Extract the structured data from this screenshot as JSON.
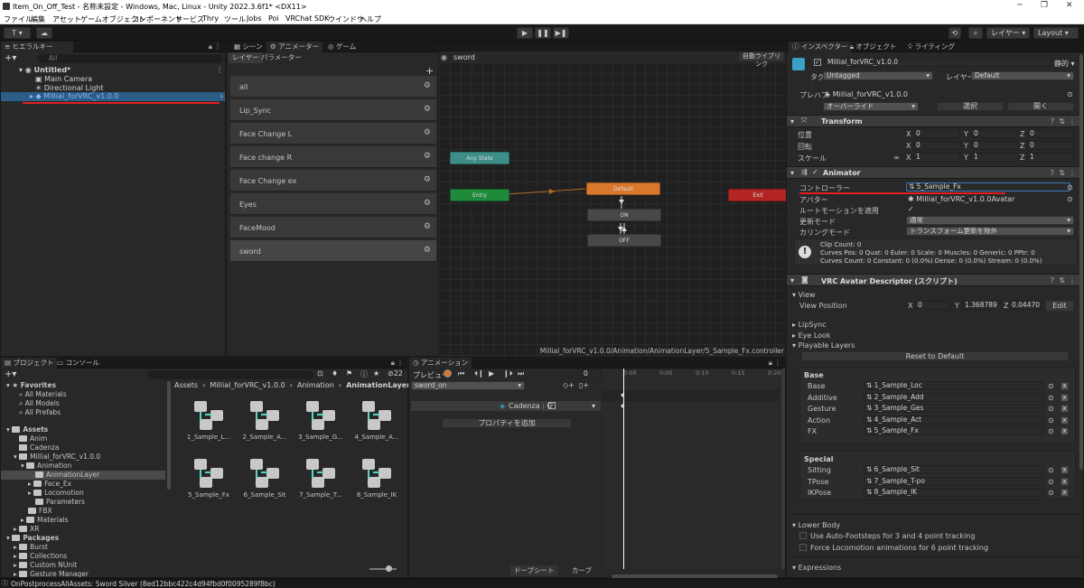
{
  "window": {
    "title": "Item_On_Off_Test - 名称未設定 - Windows, Mac, Linux - Unity 2022.3.6f1* <DX11>"
  },
  "menu": [
    "ファイル",
    "編集",
    "アセット",
    "ゲームオブジェクト",
    "コンポーネント",
    "サービス",
    "Thry",
    "ツール",
    "Jobs",
    "Poi",
    "VRChat SDK",
    "ウインドウ",
    "ヘルプ"
  ],
  "toolbar": {
    "account": "T",
    "layers": "レイヤー",
    "layout": "Layout"
  },
  "hierarchy": {
    "tab": "ヒエラルキー",
    "search_placeholder": "All",
    "scene": "Untitled*",
    "items": [
      "Main Camera",
      "Directional Light",
      "Millial_forVRC_v1.0.0"
    ]
  },
  "animator": {
    "tabs": [
      "シーン",
      "アニメーター",
      "ゲーム"
    ],
    "subtabs": [
      "レイヤー",
      "パラメーター"
    ],
    "breadcrumb": "sword",
    "auto_live_link": "自動ライブリンク",
    "layers": [
      "all",
      "Lip_Sync",
      "Face Change L",
      "Face change R",
      "Face Change ex",
      "Eyes",
      "FaceMood",
      "sword"
    ],
    "states": {
      "any": "Any State",
      "entry": "Entry",
      "default": "Default",
      "on": "ON",
      "off": "OFF",
      "exit": "Exit"
    },
    "path": "Millial_forVRC_v1.0.0/Animation/AnimationLayer/5_Sample_Fx.controller"
  },
  "inspector": {
    "tabs": [
      "インスペクター",
      "オブジェクト",
      "ライティング"
    ],
    "object_name": "Millial_forVRC_v1.0.0",
    "static": "静的",
    "tag_label": "タグ",
    "tag": "Untagged",
    "layer_label": "レイヤー",
    "layer": "Default",
    "prefab_label": "プレハブ",
    "prefab": "Millial_forVRC_v1.0.0",
    "overrides": "オーバーライド",
    "select": "選択",
    "open": "開く",
    "transform": {
      "title": "Transform",
      "position": "位置",
      "rotation": "回転",
      "scale": "スケール",
      "pos": [
        "0",
        "0",
        "0"
      ],
      "rot": [
        "0",
        "0",
        "0"
      ],
      "scl": [
        "1",
        "1",
        "1"
      ]
    },
    "animator_comp": {
      "title": "Animator",
      "controller_label": "コントローラー",
      "controller": "5_Sample_Fx",
      "avatar_label": "アバター",
      "avatar": "Millial_forVRC_v1.0.0Avatar",
      "root_motion": "ルートモーションを適用",
      "update_label": "更新モード",
      "update": "通常",
      "culling_label": "カリングモード",
      "culling": "トランスフォーム更新を除外",
      "info": [
        "Clip Count: 0",
        "Curves Pos: 0 Quat: 0 Euler: 0 Scale: 0 Muscles: 0 Generic: 0 PPtr: 0",
        "Curves Count: 0 Constant: 0 (0.0%) Dense: 0 (0.0%) Stream: 0 (0.0%)"
      ]
    },
    "descriptor": {
      "title": "VRC Avatar Descriptor (スクリプト)",
      "view": "View",
      "view_position": "View Position",
      "vp": [
        "0",
        "1.368789",
        "0.044701"
      ],
      "edit": "Edit",
      "lip_sync": "LipSync",
      "eye_look": "Eye Look",
      "playable_layers": "Playable Layers",
      "reset": "Reset to Default",
      "base_title": "Base",
      "base": [
        {
          "label": "Base",
          "value": "1_Sample_Loc"
        },
        {
          "label": "Additive",
          "value": "2_Sample_Add"
        },
        {
          "label": "Gesture",
          "value": "3_Sample_Ges"
        },
        {
          "label": "Action",
          "value": "4_Sample_Act"
        },
        {
          "label": "FX",
          "value": "5_Sample_Fx"
        }
      ],
      "special_title": "Special",
      "special": [
        {
          "label": "Sitting",
          "value": "6_Sample_Sit"
        },
        {
          "label": "TPose",
          "value": "7_Sample_T-po"
        },
        {
          "label": "IKPose",
          "value": "8_Sample_IK"
        }
      ],
      "lower_body": "Lower Body",
      "auto_footsteps": "Use Auto-Footsteps for 3 and 4 point tracking",
      "force_locomotion": "Force Locomotion animations for 6 point tracking",
      "expressions": "Expressions"
    }
  },
  "project": {
    "tabs": [
      "プロジェクト",
      "コンソール"
    ],
    "hidden_count": "22",
    "breadcrumb": [
      "Assets",
      "Millial_forVRC_v1.0.0",
      "Animation",
      "AnimationLayer"
    ],
    "favorites": "Favorites",
    "fav_items": [
      "All Materials",
      "All Models",
      "All Prefabs"
    ],
    "assets": "Assets",
    "tree": [
      "Anim",
      "Cadenza",
      "Millial_forVRC_v1.0.0",
      "Animation",
      "AnimationLayer",
      "Face_Ex",
      "Locomotion",
      "Parameters",
      "FBX",
      "Materials",
      "XR"
    ],
    "packages": "Packages",
    "pkg_items": [
      "Burst",
      "Collections",
      "Custom NUnit",
      "Gesture Manager"
    ],
    "files": [
      "1_Sample_L...",
      "2_Sample_A...",
      "3_Sample_G...",
      "4_Sample_A...",
      "5_Sample_Fx",
      "6_Sample_Sit",
      "7_Sample_T...",
      "8_Sample_IK"
    ]
  },
  "animation": {
    "tab": "アニメーション",
    "preview": "プレビュー",
    "frame": "0",
    "clip": "sword_on",
    "object": "Cadenza : C",
    "add_property": "プロパティを追加",
    "ticks": [
      "0:00",
      "0:05",
      "0:10",
      "0:15",
      "0:20",
      "0:25",
      "0:30",
      "0:35",
      "0:40",
      "0:45",
      "0:50",
      "0:55",
      "1:00"
    ],
    "dopesheet": "ドープシート",
    "curves": "カーブ"
  },
  "status": "OnPostprocessAllAssets: Sword Silver (8ed12bbc422c4d94fbd0f0095289f8bc)",
  "colors": {
    "accent": "#3a79bb",
    "state_default": "#d9782d",
    "state_entry": "#1f8a3a",
    "state_exit": "#b32525",
    "state_any": "#3c8e86",
    "underline": "#e02020"
  }
}
